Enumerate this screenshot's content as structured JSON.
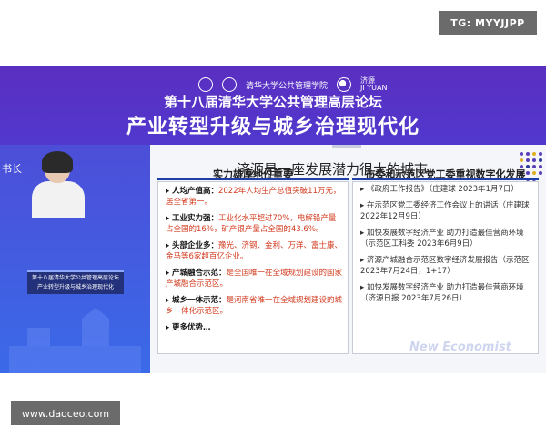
{
  "badges": {
    "top_right": "TG: MYYJJPP",
    "bottom_left": "www.daoceo.com"
  },
  "header": {
    "forum_title": "第十八届清华大学公共管理高层论坛",
    "forum_subtitle": "产业转型升级与城乡治理现代化",
    "logo1_text": "清华大学公共管理学院",
    "logo2_text": "济源",
    "logo2_sub": "JI YUAN"
  },
  "left_panel": {
    "speaker_tag": "书长",
    "podium_line1": "第十八届清华大学公共管理高层论坛",
    "podium_line2": "产业转型升级与城乡治理现代化"
  },
  "slide": {
    "title": "济源是一座发展潜力很大的城市",
    "left_header": "实力雄厚地位重要",
    "right_header": "市委和示范区党工委重视数字化发展",
    "left_items": [
      {
        "key": "人均产值高：",
        "text": "2022年人均生产总值突破11万元，居全省第一。"
      },
      {
        "key": "工业实力强：",
        "text": "工业化水平超过70%，电解铅产量占全国的16%，矿产银产量占全国的43.6%。"
      },
      {
        "key": "头部企业多：",
        "text": "豫光、济钢、金利、万洋、富士康、金马等6家超百亿企业。"
      },
      {
        "key": "产城融合示范：",
        "text": "是全国唯一在全域规划建设的国家产城融合示范区。"
      },
      {
        "key": "城乡一体示范：",
        "text": "是河南省唯一在全域规划建设的城乡一体化示范区。"
      },
      {
        "key": "更多优势…",
        "text": ""
      }
    ],
    "right_items": [
      "《政府工作报告》（庄建球 2023年1月7日）",
      "在示范区党工委经济工作会议上的讲话（庄建球 2022年12月9日）",
      "加快发展数字经济产业 助力打造最佳营商环境（示范区工科委 2023年6月9日）",
      "济源产城融合示范区数字经济发展报告（示范区 2023年7月24日，1+17）",
      "加快发展数字经济产业 助力打造最佳营商环境（济源日报 2023年7月26日）"
    ]
  },
  "watermark": "New Economist"
}
